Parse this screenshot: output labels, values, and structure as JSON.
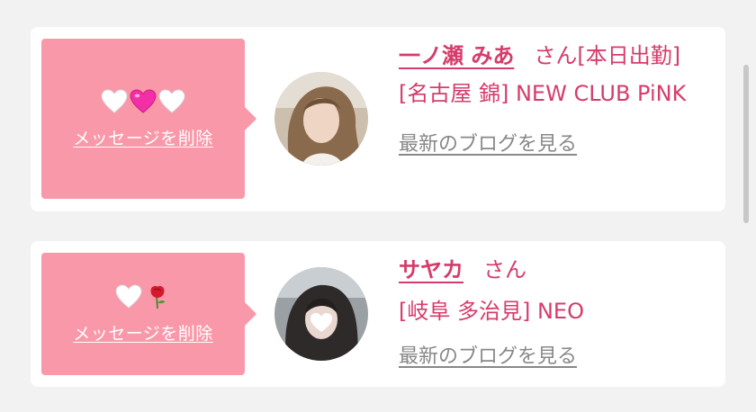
{
  "cards": [
    {
      "stamps": [
        "white-heart-icon",
        "pink-heart-icon",
        "white-heart-icon"
      ],
      "delete_label": "メッセージを削除",
      "name": "一ノ瀬 みあ",
      "suffix": "さん",
      "status": "[本日出勤]",
      "shop": "[名古屋 錦] NEW CLUB PiNK",
      "blog_label": "最新のブログを見る"
    },
    {
      "stamps": [
        "white-heart-icon",
        "rose-icon"
      ],
      "delete_label": "メッセージを削除",
      "name": "サヤカ",
      "suffix": "さん",
      "status": "",
      "shop": "[岐阜 多治見] NEO",
      "blog_label": "最新のブログを見る"
    }
  ],
  "colors": {
    "accent": "#d63c6b",
    "message_box": "#f998a9",
    "link_gray": "#888888"
  }
}
